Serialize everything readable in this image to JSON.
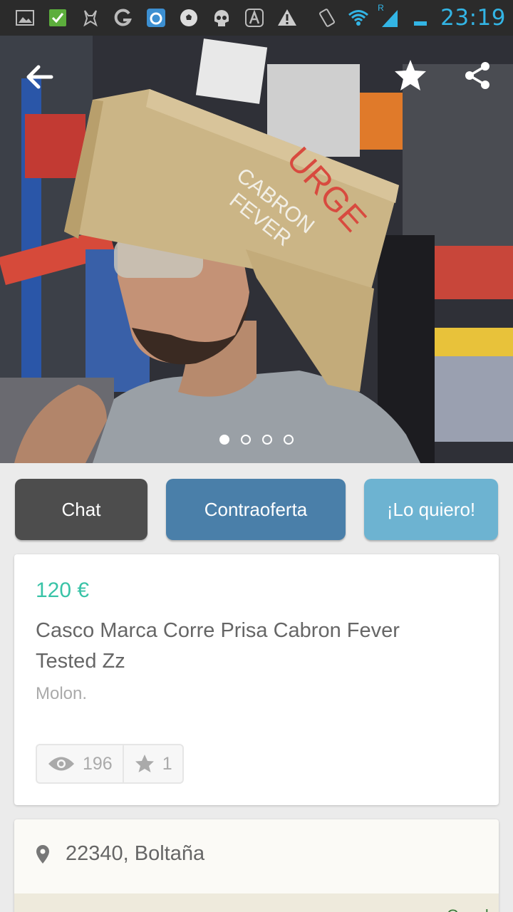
{
  "status_bar": {
    "time": "23:19",
    "icons": [
      "image-icon",
      "check-icon",
      "app-icon",
      "g-icon",
      "drop-icon",
      "soccer-ball-icon",
      "skull-icon",
      "a-icon",
      "warning-icon",
      "vibrate-icon",
      "wifi-icon",
      "signal-icon",
      "battery-icon"
    ],
    "roaming_label": "R"
  },
  "header": {
    "back_icon": "arrow-left-icon",
    "favorite_icon": "star-icon",
    "share_icon": "share-icon"
  },
  "gallery": {
    "image_count": 4,
    "active_index": 0,
    "box_text_1": "URGE",
    "box_text_2": "CABRON",
    "box_text_3": "FEVER"
  },
  "actions": {
    "chat_label": "Chat",
    "counter_label": "Contraoferta",
    "want_label": "¡Lo quiero!"
  },
  "product": {
    "price": "120 €",
    "title": "Casco Marca Corre Prisa Cabron Fever Tested Zz",
    "description": "Molon.",
    "views": "196",
    "favorites": "1"
  },
  "location": {
    "text": "22340, Boltaña",
    "map_label": "Google"
  },
  "colors": {
    "price": "#39c3a7",
    "chat": "#4d4d4d",
    "counter": "#4a7fa9",
    "want": "#6db3d1",
    "status_time": "#33b5e5"
  }
}
